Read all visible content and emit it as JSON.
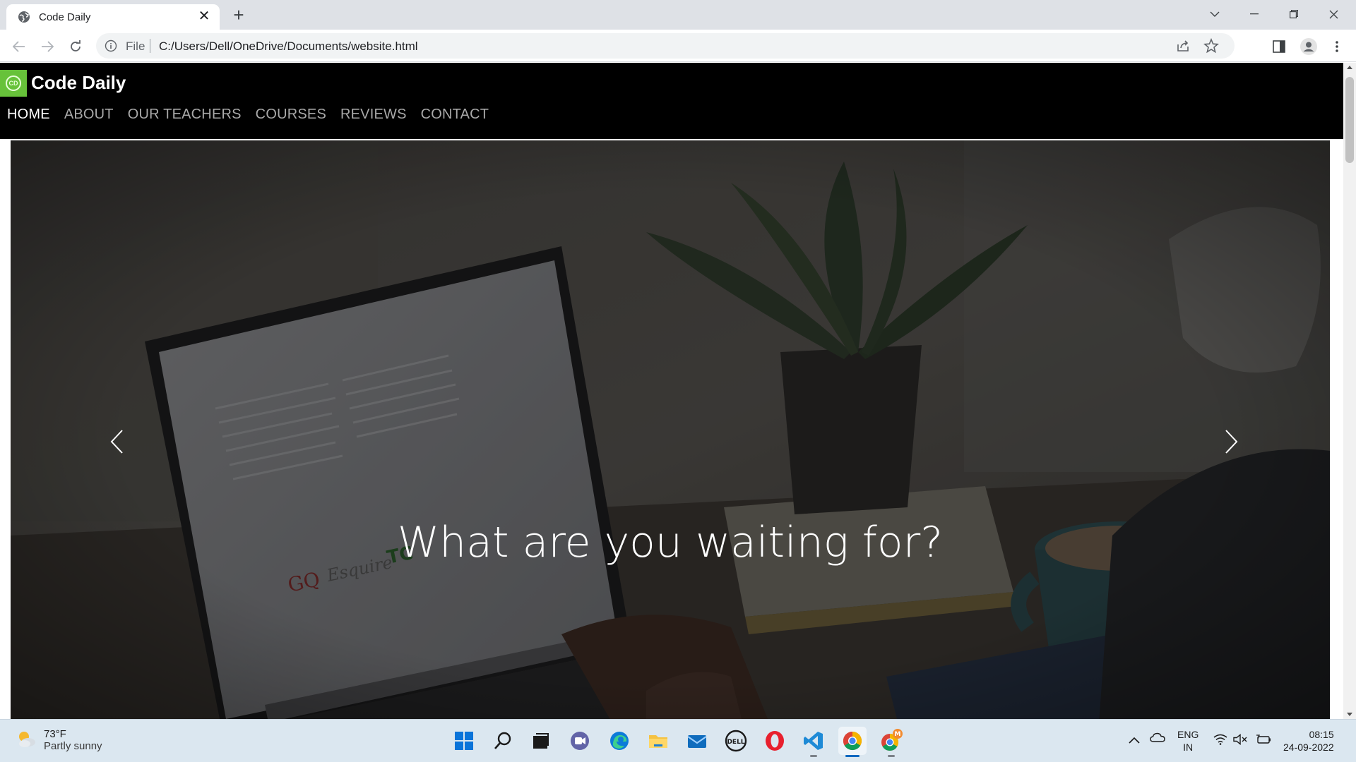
{
  "browser": {
    "tab_title": "Code Daily",
    "url_scheme": "File",
    "url": "C:/Users/Dell/OneDrive/Documents/website.html"
  },
  "site": {
    "brand": "Code Daily",
    "nav": [
      "HOME",
      "ABOUT",
      "OUR TEACHERS",
      "COURSES",
      "REVIEWS",
      "CONTACT"
    ],
    "active_nav": "HOME",
    "hero_caption": "What are you waiting for?",
    "colors": {
      "header_bg": "#000000",
      "logo_green": "#67c23a",
      "nav_inactive": "#a9a9a9"
    }
  },
  "taskbar": {
    "weather_temp": "73°F",
    "weather_desc": "Partly sunny",
    "lang": "ENG",
    "region": "IN",
    "time": "08:15",
    "date": "24-09-2022",
    "badge": "M"
  }
}
